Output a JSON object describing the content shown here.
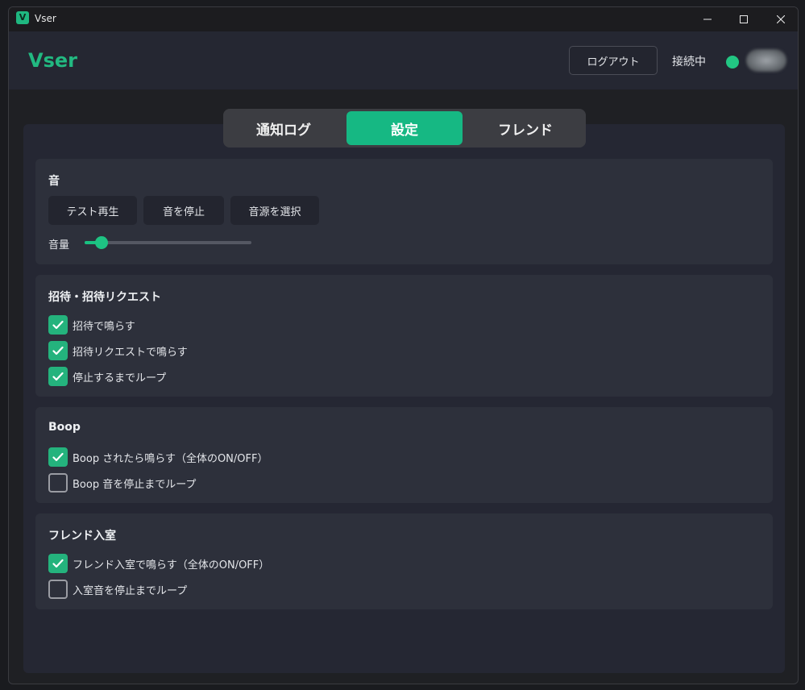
{
  "window": {
    "title": "Vser",
    "app_icon_letter": "V"
  },
  "header": {
    "brand": "Vser",
    "logout_label": "ログアウト",
    "connection_status": "接続中",
    "status_color": "#22c683"
  },
  "tabs": [
    {
      "label": "通知ログ",
      "active": false
    },
    {
      "label": "設定",
      "active": true
    },
    {
      "label": "フレンド",
      "active": false
    }
  ],
  "sections": {
    "sound": {
      "title": "音",
      "buttons": [
        "テスト再生",
        "音を停止",
        "音源を選択"
      ],
      "volume_label": "音量",
      "volume_value": 0.1
    },
    "invite": {
      "title": "招待・招待リクエスト",
      "options": [
        {
          "label": "招待で鳴らす",
          "checked": true
        },
        {
          "label": "招待リクエストで鳴らす",
          "checked": true
        },
        {
          "label": "停止するまでループ",
          "checked": true
        }
      ]
    },
    "boop": {
      "title": "Boop",
      "options": [
        {
          "label": "Boop されたら鳴らす（全体のON/OFF）",
          "checked": true
        },
        {
          "label": "Boop 音を停止までループ",
          "checked": false
        }
      ]
    },
    "friend_join": {
      "title": "フレンド入室",
      "options": [
        {
          "label": "フレンド入室で鳴らす（全体のON/OFF）",
          "checked": true
        },
        {
          "label": "入室音を停止までループ",
          "checked": false
        }
      ]
    }
  },
  "colors": {
    "accent": "#16b883",
    "background": "#252733",
    "card": "#2d303b"
  }
}
